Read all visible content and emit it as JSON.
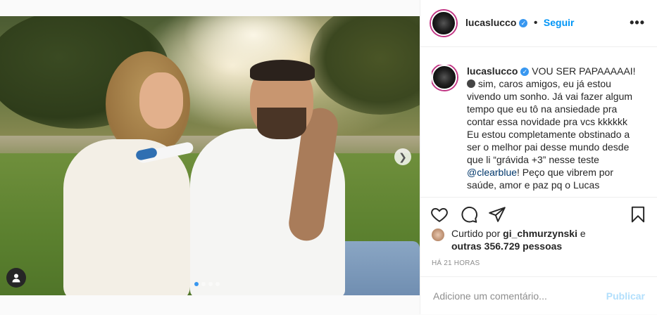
{
  "post": {
    "username": "lucaslucco",
    "follow_label": "Seguir",
    "more_label": "•••",
    "caption_lines": [
      "VOU SER PAPAAAAAI!",
      " sim, caros amigos, eu já estou",
      "vivendo um sonho. Já vai fazer algum",
      "tempo que eu tô na ansiedade pra",
      "contar essa novidade pra vcs kkkkkk",
      "Eu estou completamente obstinado a",
      "ser o melhor pai desse mundo desde",
      "que li “grávida +3” nesse teste"
    ],
    "caption_mention": "@clearblue",
    "caption_after_mention": "! Peço que vibrem por",
    "caption_last_line": "saúde, amor e paz pq o Lucas",
    "likes_prefix": "Curtido por ",
    "likes_user": "gi_chmurzynski",
    "likes_mid": " e",
    "likes_others": "outras 356.729 pessoas",
    "timestamp": "HÁ 21 HORAS",
    "comment_placeholder": "Adicione um comentário...",
    "publish_label": "Publicar"
  },
  "carousel": {
    "current": 1,
    "total": 4,
    "next_icon": "chevron-right-icon"
  },
  "icons": {
    "like": "heart-icon",
    "comment": "comment-icon",
    "share": "paper-plane-icon",
    "save": "bookmark-icon",
    "tag": "user-tag-icon",
    "verified": "verified-badge-icon"
  },
  "colors": {
    "link": "#0095f6",
    "verified": "#3897f0",
    "publish_disabled": "#b2dffc"
  }
}
